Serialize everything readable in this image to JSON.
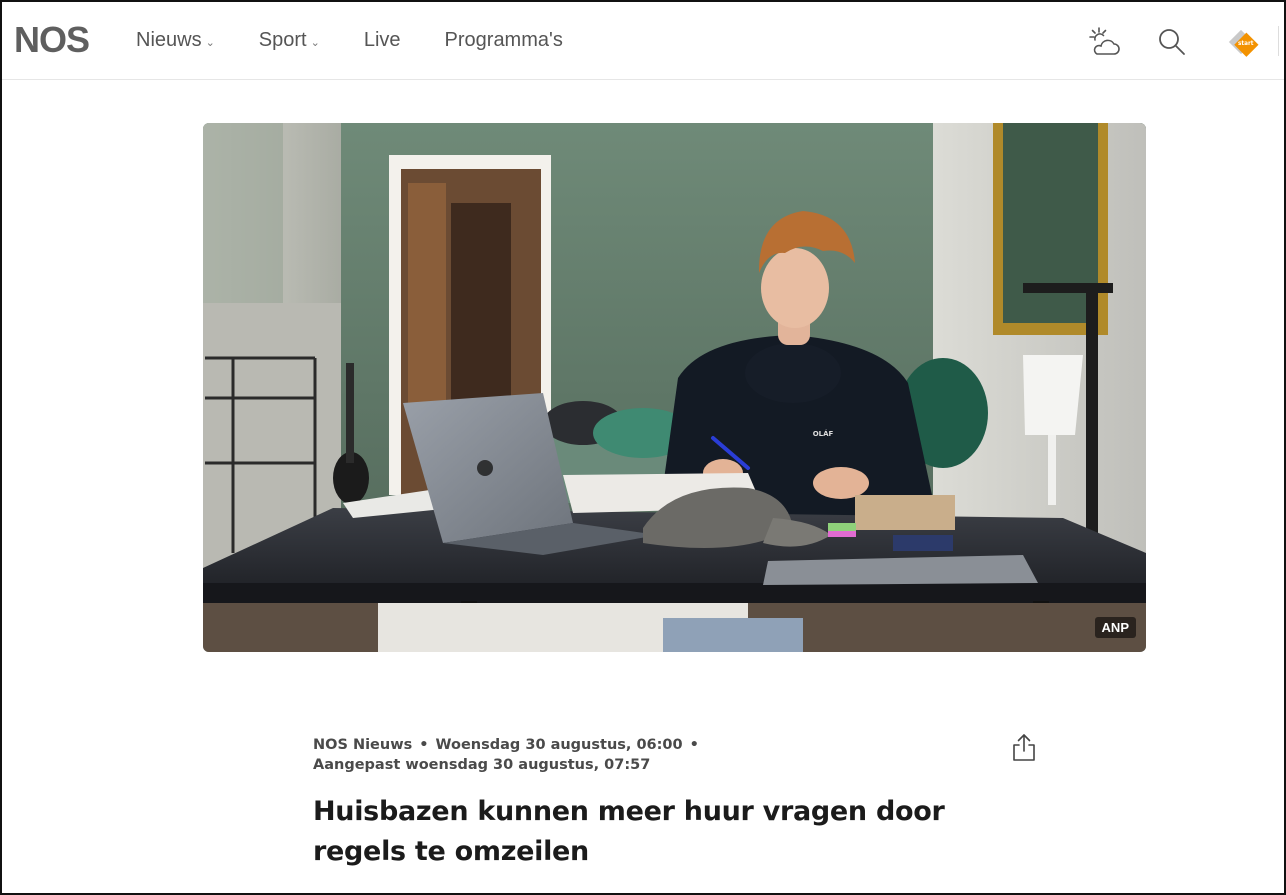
{
  "header": {
    "logo": "NOS",
    "nav": [
      {
        "label": "Nieuws",
        "has_dropdown": true
      },
      {
        "label": "Sport",
        "has_dropdown": true
      },
      {
        "label": "Live",
        "has_dropdown": false
      },
      {
        "label": "Programma's",
        "has_dropdown": false
      }
    ],
    "chevron": "⌄",
    "icons": [
      "weather-icon",
      "search-icon",
      "npo-start-icon"
    ],
    "npo_start_text": "start"
  },
  "hero": {
    "credit": "ANP",
    "hoodie_text": "OLÁF"
  },
  "article": {
    "source": "NOS Nieuws",
    "separator": "•",
    "published": "Woensdag 30 augustus, 06:00",
    "updated": "Aangepast woensdag 30 augustus, 07:57",
    "headline": "Huisbazen kunnen meer huur vragen door regels te omzeilen"
  },
  "colors": {
    "logo": "#5f5f5f",
    "npo_orange": "#f39200",
    "text_dark": "#1b1b1b",
    "text_meta": "#4a4a4a"
  }
}
